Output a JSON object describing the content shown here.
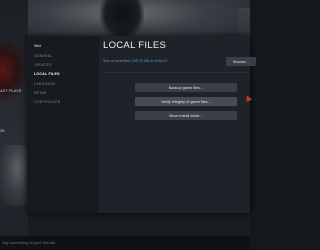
{
  "background": {
    "left_texts": [
      "AST PLAYE",
      "35"
    ],
    "chat_placeholder": "Say something to your friends..."
  },
  "dialog": {
    "sidebar": {
      "title": "Wild",
      "items": [
        {
          "label": "GENERAL",
          "active": false
        },
        {
          "label": "UPDATES",
          "active": false
        },
        {
          "label": "LOCAL FILES",
          "active": true
        },
        {
          "label": "LANGUAGE",
          "active": false
        },
        {
          "label": "BETAS",
          "active": false
        },
        {
          "label": "CONTROLLER",
          "active": false
        }
      ]
    },
    "main": {
      "title": "LOCAL FILES",
      "size_label": "Size of local files:",
      "size_value": "109.75 GB on Drive D:",
      "browse_label": "Browse...",
      "buttons": [
        {
          "label": "Backup game files..."
        },
        {
          "label": "Verify integrity of game files..."
        },
        {
          "label": "Move install folder..."
        }
      ]
    }
  },
  "colors": {
    "accent": "#3fa6e3",
    "panel": "#1f2329",
    "sidebar": "#171a1f",
    "button": "#3a3f47"
  }
}
